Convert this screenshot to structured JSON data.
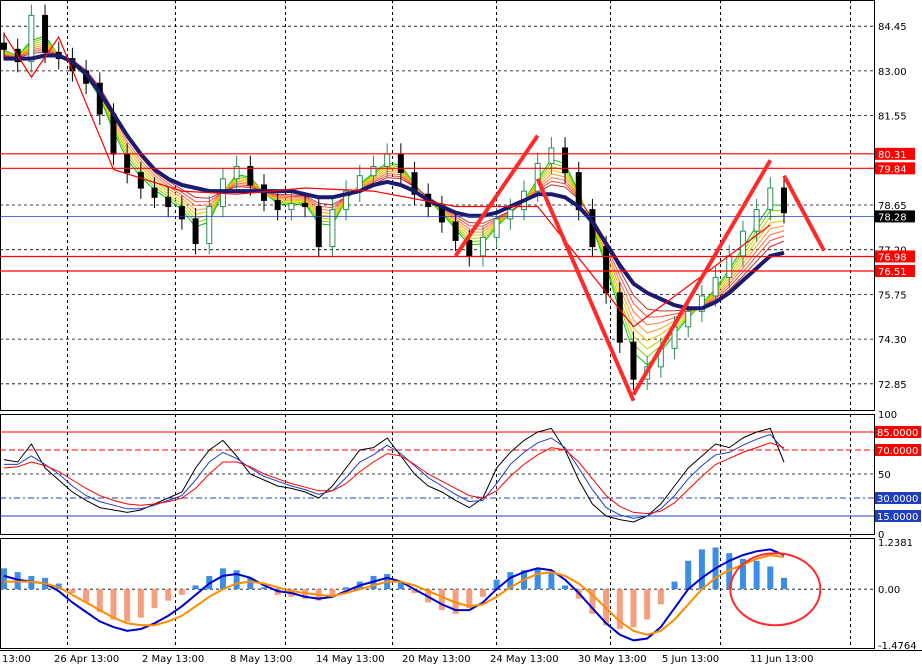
{
  "chart_data": [
    {
      "type": "candlestick",
      "panel": "price",
      "ylim": [
        72.0,
        85.3
      ],
      "price_ticks": [
        "84.45",
        "83.00",
        "81.55",
        "78.65",
        "77.20",
        "75.75",
        "74.30",
        "72.85"
      ],
      "price_tick_values": [
        84.45,
        83.0,
        81.55,
        78.65,
        77.2,
        75.75,
        74.3,
        72.85
      ],
      "horizontal_levels": [
        {
          "label": "80.31",
          "value": 80.31,
          "color": "#ff0000"
        },
        {
          "label": "79.84",
          "value": 79.84,
          "color": "#ff0000"
        },
        {
          "label": "76.98",
          "value": 76.98,
          "color": "#ff0000"
        },
        {
          "label": "76.51",
          "value": 76.51,
          "color": "#ff0000"
        }
      ],
      "current_price": {
        "label": "78.28",
        "value": 78.28,
        "color": "#1f3fbf"
      },
      "close_path": [
        83.7,
        83.3,
        84.8,
        83.6,
        83.4,
        83.0,
        82.6,
        81.6,
        80.3,
        79.7,
        79.2,
        78.9,
        78.6,
        78.2,
        77.4,
        78.6,
        79.5,
        79.9,
        79.3,
        78.8,
        78.5,
        78.7,
        78.6,
        77.3,
        78.5,
        79.1,
        79.6,
        79.9,
        80.3,
        79.7,
        79.0,
        78.6,
        78.1,
        77.5,
        77.0,
        77.6,
        78.2,
        78.5,
        79.1,
        80.0,
        80.5,
        79.7,
        78.5,
        77.3,
        75.8,
        74.2,
        73.0,
        73.4,
        74.0,
        74.7,
        75.2,
        75.7,
        76.3,
        77.0,
        77.8,
        78.5,
        79.2,
        78.4
      ],
      "moving_average_path": [
        83.4,
        83.4,
        83.4,
        83.5,
        83.5,
        83.3,
        82.9,
        82.3,
        81.6,
        80.9,
        80.3,
        79.8,
        79.5,
        79.3,
        79.2,
        79.1,
        79.1,
        79.1,
        79.1,
        79.1,
        79.1,
        79.1,
        79.0,
        78.9,
        78.9,
        79.0,
        79.1,
        79.3,
        79.4,
        79.3,
        79.1,
        78.8,
        78.6,
        78.4,
        78.3,
        78.3,
        78.4,
        78.6,
        78.8,
        79.0,
        79.0,
        78.9,
        78.6,
        78.1,
        77.4,
        76.7,
        76.1,
        75.8,
        75.6,
        75.4,
        75.3,
        75.3,
        75.5,
        75.8,
        76.2,
        76.6,
        77.0,
        77.1
      ],
      "ribbon_colors": [
        "#00c000",
        "#7fd000",
        "#c8d000",
        "#f0c000",
        "#ff9a30",
        "#ff7040",
        "#f05040",
        "#c03030"
      ],
      "zigzag_annotation_color": "#ff0000"
    },
    {
      "type": "line",
      "panel": "stochastic",
      "ylim": [
        0,
        100
      ],
      "ticks": [
        "100",
        "50",
        "0"
      ],
      "tick_values": [
        100,
        50,
        0
      ],
      "levels": [
        {
          "label": "85.0000",
          "value": 85,
          "color": "#ff0000"
        },
        {
          "label": "70.0000",
          "value": 70,
          "color": "#ff0000"
        },
        {
          "label": "30.0000",
          "value": 30,
          "color": "#1f3fbf"
        },
        {
          "label": "15.0000",
          "value": 15,
          "color": "#1f3fbf"
        }
      ],
      "series": [
        {
          "color": "#000000",
          "values": [
            62,
            60,
            75,
            55,
            45,
            35,
            28,
            22,
            20,
            18,
            20,
            25,
            30,
            35,
            55,
            70,
            78,
            65,
            50,
            45,
            40,
            38,
            35,
            30,
            40,
            55,
            70,
            72,
            80,
            65,
            50,
            40,
            35,
            28,
            22,
            30,
            55,
            68,
            78,
            85,
            88,
            70,
            45,
            25,
            15,
            12,
            10,
            15,
            25,
            40,
            55,
            65,
            75,
            72,
            80,
            85,
            88,
            60
          ]
        },
        {
          "color": "#1f3fbf",
          "values": [
            58,
            58,
            65,
            58,
            50,
            40,
            32,
            27,
            24,
            21,
            21,
            24,
            28,
            32,
            45,
            60,
            68,
            63,
            55,
            48,
            44,
            40,
            37,
            33,
            36,
            47,
            60,
            66,
            74,
            67,
            57,
            47,
            40,
            33,
            27,
            28,
            42,
            58,
            68,
            76,
            80,
            72,
            55,
            37,
            22,
            16,
            13,
            15,
            21,
            32,
            46,
            57,
            66,
            68,
            74,
            79,
            83,
            70
          ]
        },
        {
          "color": "#ff0000",
          "values": [
            55,
            56,
            60,
            57,
            52,
            45,
            38,
            32,
            28,
            25,
            24,
            25,
            27,
            30,
            38,
            50,
            60,
            60,
            56,
            50,
            46,
            42,
            39,
            36,
            36,
            42,
            52,
            60,
            67,
            65,
            58,
            50,
            44,
            38,
            32,
            30,
            36,
            48,
            58,
            66,
            72,
            70,
            60,
            46,
            32,
            23,
            18,
            17,
            19,
            26,
            37,
            48,
            58,
            63,
            68,
            72,
            76,
            72
          ]
        }
      ]
    },
    {
      "type": "bar",
      "panel": "macd",
      "ylim": [
        -1.55,
        1.35
      ],
      "ticks": [
        "1.2381",
        "0.00",
        "-1.4764"
      ],
      "tick_values": [
        1.2381,
        0.0,
        -1.4764
      ],
      "histogram": [
        0.55,
        0.45,
        0.35,
        0.3,
        0.15,
        -0.1,
        -0.35,
        -0.6,
        -0.8,
        -0.85,
        -0.75,
        -0.5,
        -0.3,
        -0.15,
        0.1,
        0.35,
        0.55,
        0.5,
        0.3,
        0.05,
        -0.15,
        -0.2,
        -0.25,
        -0.3,
        -0.15,
        0.05,
        0.2,
        0.35,
        0.4,
        0.2,
        -0.1,
        -0.35,
        -0.55,
        -0.65,
        -0.5,
        -0.2,
        0.25,
        0.45,
        0.5,
        0.55,
        0.45,
        0.1,
        -0.25,
        -0.65,
        -0.95,
        -1.05,
        -1.0,
        -0.8,
        -0.4,
        0.2,
        0.75,
        1.05,
        1.1,
        0.95,
        0.8,
        0.75,
        0.6,
        0.3
      ],
      "series": [
        {
          "color": "#0000cc",
          "values": [
            0.35,
            0.25,
            0.2,
            0.15,
            -0.05,
            -0.35,
            -0.6,
            -0.85,
            -1.0,
            -1.1,
            -1.05,
            -0.9,
            -0.7,
            -0.45,
            -0.15,
            0.15,
            0.35,
            0.4,
            0.3,
            0.1,
            -0.05,
            -0.1,
            -0.2,
            -0.25,
            -0.2,
            -0.05,
            0.1,
            0.2,
            0.3,
            0.2,
            0.0,
            -0.2,
            -0.4,
            -0.55,
            -0.55,
            -0.35,
            0.0,
            0.3,
            0.45,
            0.55,
            0.5,
            0.25,
            -0.1,
            -0.5,
            -0.9,
            -1.2,
            -1.35,
            -1.3,
            -1.0,
            -0.5,
            0.0,
            0.3,
            0.55,
            0.75,
            0.9,
            1.0,
            1.05,
            0.9
          ]
        },
        {
          "color": "#ff8c00",
          "values": [
            0.2,
            0.2,
            0.2,
            0.15,
            0.05,
            -0.15,
            -0.35,
            -0.55,
            -0.75,
            -0.9,
            -0.95,
            -0.95,
            -0.85,
            -0.7,
            -0.45,
            -0.2,
            0.0,
            0.15,
            0.2,
            0.15,
            0.05,
            -0.05,
            -0.1,
            -0.15,
            -0.18,
            -0.1,
            0.0,
            0.1,
            0.2,
            0.2,
            0.1,
            -0.05,
            -0.2,
            -0.35,
            -0.45,
            -0.4,
            -0.2,
            0.05,
            0.25,
            0.4,
            0.45,
            0.35,
            0.15,
            -0.15,
            -0.5,
            -0.85,
            -1.1,
            -1.2,
            -1.1,
            -0.8,
            -0.4,
            0.0,
            0.3,
            0.5,
            0.65,
            0.8,
            0.9,
            0.85
          ]
        }
      ]
    }
  ],
  "time_labels": [
    "13:00",
    "26 Apr 13:00",
    "2 May 13:00",
    "8 May 13:00",
    "14 May 13:00",
    "20 May 13:00",
    "24 May 13:00",
    "30 May 13:00",
    "5 Jun 13:00",
    "11 Jun 13:00"
  ],
  "colors": {
    "background": "#ffffff",
    "grid": "#000000",
    "candle_up": "#2e8b57",
    "candle_down": "#000000",
    "blue_level": "#1f3fbf",
    "red_level": "#ff0000"
  }
}
